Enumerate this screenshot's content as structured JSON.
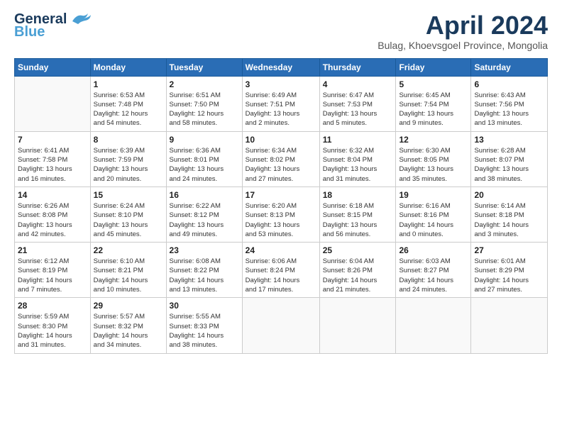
{
  "header": {
    "logo_line1": "General",
    "logo_line2": "Blue",
    "month_title": "April 2024",
    "location": "Bulag, Khoevsgoel Province, Mongolia"
  },
  "weekdays": [
    "Sunday",
    "Monday",
    "Tuesday",
    "Wednesday",
    "Thursday",
    "Friday",
    "Saturday"
  ],
  "weeks": [
    [
      {
        "day": "",
        "info": ""
      },
      {
        "day": "1",
        "info": "Sunrise: 6:53 AM\nSunset: 7:48 PM\nDaylight: 12 hours\nand 54 minutes."
      },
      {
        "day": "2",
        "info": "Sunrise: 6:51 AM\nSunset: 7:50 PM\nDaylight: 12 hours\nand 58 minutes."
      },
      {
        "day": "3",
        "info": "Sunrise: 6:49 AM\nSunset: 7:51 PM\nDaylight: 13 hours\nand 2 minutes."
      },
      {
        "day": "4",
        "info": "Sunrise: 6:47 AM\nSunset: 7:53 PM\nDaylight: 13 hours\nand 5 minutes."
      },
      {
        "day": "5",
        "info": "Sunrise: 6:45 AM\nSunset: 7:54 PM\nDaylight: 13 hours\nand 9 minutes."
      },
      {
        "day": "6",
        "info": "Sunrise: 6:43 AM\nSunset: 7:56 PM\nDaylight: 13 hours\nand 13 minutes."
      }
    ],
    [
      {
        "day": "7",
        "info": "Sunrise: 6:41 AM\nSunset: 7:58 PM\nDaylight: 13 hours\nand 16 minutes."
      },
      {
        "day": "8",
        "info": "Sunrise: 6:39 AM\nSunset: 7:59 PM\nDaylight: 13 hours\nand 20 minutes."
      },
      {
        "day": "9",
        "info": "Sunrise: 6:36 AM\nSunset: 8:01 PM\nDaylight: 13 hours\nand 24 minutes."
      },
      {
        "day": "10",
        "info": "Sunrise: 6:34 AM\nSunset: 8:02 PM\nDaylight: 13 hours\nand 27 minutes."
      },
      {
        "day": "11",
        "info": "Sunrise: 6:32 AM\nSunset: 8:04 PM\nDaylight: 13 hours\nand 31 minutes."
      },
      {
        "day": "12",
        "info": "Sunrise: 6:30 AM\nSunset: 8:05 PM\nDaylight: 13 hours\nand 35 minutes."
      },
      {
        "day": "13",
        "info": "Sunrise: 6:28 AM\nSunset: 8:07 PM\nDaylight: 13 hours\nand 38 minutes."
      }
    ],
    [
      {
        "day": "14",
        "info": "Sunrise: 6:26 AM\nSunset: 8:08 PM\nDaylight: 13 hours\nand 42 minutes."
      },
      {
        "day": "15",
        "info": "Sunrise: 6:24 AM\nSunset: 8:10 PM\nDaylight: 13 hours\nand 45 minutes."
      },
      {
        "day": "16",
        "info": "Sunrise: 6:22 AM\nSunset: 8:12 PM\nDaylight: 13 hours\nand 49 minutes."
      },
      {
        "day": "17",
        "info": "Sunrise: 6:20 AM\nSunset: 8:13 PM\nDaylight: 13 hours\nand 53 minutes."
      },
      {
        "day": "18",
        "info": "Sunrise: 6:18 AM\nSunset: 8:15 PM\nDaylight: 13 hours\nand 56 minutes."
      },
      {
        "day": "19",
        "info": "Sunrise: 6:16 AM\nSunset: 8:16 PM\nDaylight: 14 hours\nand 0 minutes."
      },
      {
        "day": "20",
        "info": "Sunrise: 6:14 AM\nSunset: 8:18 PM\nDaylight: 14 hours\nand 3 minutes."
      }
    ],
    [
      {
        "day": "21",
        "info": "Sunrise: 6:12 AM\nSunset: 8:19 PM\nDaylight: 14 hours\nand 7 minutes."
      },
      {
        "day": "22",
        "info": "Sunrise: 6:10 AM\nSunset: 8:21 PM\nDaylight: 14 hours\nand 10 minutes."
      },
      {
        "day": "23",
        "info": "Sunrise: 6:08 AM\nSunset: 8:22 PM\nDaylight: 14 hours\nand 13 minutes."
      },
      {
        "day": "24",
        "info": "Sunrise: 6:06 AM\nSunset: 8:24 PM\nDaylight: 14 hours\nand 17 minutes."
      },
      {
        "day": "25",
        "info": "Sunrise: 6:04 AM\nSunset: 8:26 PM\nDaylight: 14 hours\nand 21 minutes."
      },
      {
        "day": "26",
        "info": "Sunrise: 6:03 AM\nSunset: 8:27 PM\nDaylight: 14 hours\nand 24 minutes."
      },
      {
        "day": "27",
        "info": "Sunrise: 6:01 AM\nSunset: 8:29 PM\nDaylight: 14 hours\nand 27 minutes."
      }
    ],
    [
      {
        "day": "28",
        "info": "Sunrise: 5:59 AM\nSunset: 8:30 PM\nDaylight: 14 hours\nand 31 minutes."
      },
      {
        "day": "29",
        "info": "Sunrise: 5:57 AM\nSunset: 8:32 PM\nDaylight: 14 hours\nand 34 minutes."
      },
      {
        "day": "30",
        "info": "Sunrise: 5:55 AM\nSunset: 8:33 PM\nDaylight: 14 hours\nand 38 minutes."
      },
      {
        "day": "",
        "info": ""
      },
      {
        "day": "",
        "info": ""
      },
      {
        "day": "",
        "info": ""
      },
      {
        "day": "",
        "info": ""
      }
    ]
  ]
}
